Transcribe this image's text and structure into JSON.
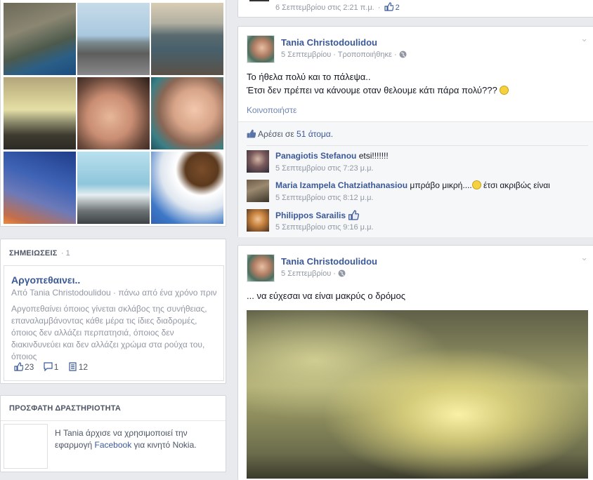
{
  "photos_grid": {
    "items": [
      "photo-cliff-beach",
      "photo-promenade",
      "photo-harbor-sunset",
      "photo-cloudy-road",
      "photo-sunglasses-portrait",
      "photo-smiling-portrait",
      "photo-plane-sky",
      "photo-white-tower",
      "photo-umbrella-clouds"
    ]
  },
  "top_strip": {
    "timestamp": "6 Σεπτεμβρίου στις 2:21 π.μ.",
    "like_count": "2"
  },
  "notes": {
    "header": "ΣΗΜΕΙΩΣΕΙΣ",
    "count": "· 1",
    "title": "Αργοπεθαινει..",
    "meta": "Από Tania Christodoulidou · πάνω από ένα χρόνο πριν",
    "body": "Αργοπεθαίνει όποιος γίνεται σκλάβος της συνήθειας, επαναλαμβάνοντας κάθε μέρα τις ίδιες διαδρομές, όποιος δεν αλλάζει περπατησιά, όποιος δεν διακινδυνεύει και δεν αλλάζει χρώμα στα ρούχα του, όποιος",
    "likes": "23",
    "comments": "1",
    "views": "12"
  },
  "recent": {
    "header": "ΠΡΟΣΦΑΤΗ ΔΡΑΣΤΗΡΙΟΤΗΤΑ",
    "text_before": "Η Tania άρχισε να χρησιμοποιεί την εφαρμογή ",
    "link": "Facebook",
    "text_after": " για κινητό Nokia."
  },
  "post1": {
    "author": "Tania Christodoulidou",
    "date": "5 Σεπτεμβρίου",
    "edited": "· Τροποποιήθηκε ·",
    "text_line1": "Το ήθελα πολύ και το πάλεψα..",
    "text_line2": "Έτσι δεν πρέπει να κάνουμε οταν θελουμε κάτι πάρα πολύ???",
    "share": "Κοινοποιήστε",
    "likes_prefix": "Αρέσει σε ",
    "likes_link": "51 άτομα",
    "likes_suffix": ".",
    "comments": [
      {
        "name": "Panagiotis Stefanou",
        "text": "etsi!!!!!!!",
        "time": "5 Σεπτεμβρίου στις 7:23 μ.μ."
      },
      {
        "name": "Maria Izampela Chatziathanasiou",
        "text": "μπράβο μικρή....",
        "text2": "έτσι ακριβώς είναι",
        "time": "5 Σεπτεμβρίου στις 8:12 μ.μ."
      },
      {
        "name": "Philippos Sarailis",
        "text": "",
        "time": "5 Σεπτεμβρίου στις 9:16 μ.μ."
      }
    ]
  },
  "post2": {
    "author": "Tania Christodoulidou",
    "date": "5 Σεπτεμβρίου",
    "sep": "·",
    "text": "... να εύχεσαι να είναι μακρύς ο δρόμος"
  },
  "colors": {
    "brand_link": "#3b5998",
    "page_bg": "#e9eaed",
    "muted": "#9197a3"
  }
}
